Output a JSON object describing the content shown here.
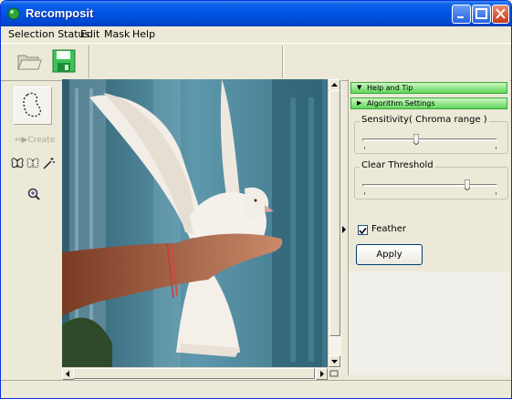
{
  "window": {
    "title": "Recomposit"
  },
  "menu": {
    "items": [
      {
        "label": "Selection Status"
      },
      {
        "label": "Edit"
      },
      {
        "label": "Mask"
      },
      {
        "label": "Help"
      }
    ]
  },
  "toolbar": {
    "icons": [
      "open-folder-icon",
      "save-disk-icon"
    ]
  },
  "tools": {
    "lasso_icon": "lasso-selection-icon",
    "create_label": "Create",
    "small_icons": [
      "butterfly-icon",
      "butterfly-outline-icon",
      "magic-wand-icon"
    ],
    "zoom_icon": "zoom-icon"
  },
  "panel": {
    "sections": [
      {
        "label": "Help and Tip",
        "expanded": true
      },
      {
        "label": "Algorithm Settings",
        "expanded": false
      }
    ],
    "sensitivity": {
      "label": "Sensitivity( Chroma range )",
      "value_fraction": 0.4
    },
    "clear_threshold": {
      "label": "Clear Threshold",
      "value_fraction": 0.78
    },
    "feather": {
      "label": "Feather",
      "checked": true
    },
    "apply_label": "Apply"
  },
  "colors": {
    "titlebar": "#0054e3",
    "section_bar": "#5fd65a",
    "canvas_bg": "#49839a"
  }
}
